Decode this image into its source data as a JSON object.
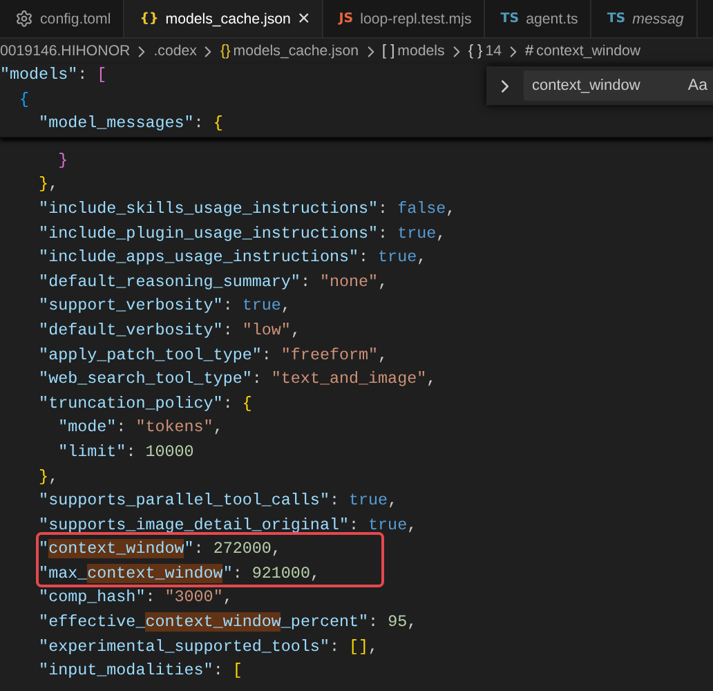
{
  "tabs": [
    {
      "kind": "gear",
      "label": "config.toml",
      "selected": false,
      "italic": false
    },
    {
      "kind": "json",
      "icon": "{}",
      "label": "models_cache.json",
      "selected": true,
      "italic": false,
      "close": "×"
    },
    {
      "kind": "js",
      "icon": "JS",
      "label": "loop-repl.test.mjs",
      "selected": false,
      "italic": false
    },
    {
      "kind": "ts",
      "icon": "TS",
      "label": "agent.ts",
      "selected": false,
      "italic": false
    },
    {
      "kind": "ts",
      "icon": "TS",
      "label": "messag",
      "selected": false,
      "italic": true
    }
  ],
  "breadcrumbs": [
    {
      "label": "0019146.HIHONOR"
    },
    {
      "label": ".codex"
    },
    {
      "icon": "{}",
      "kind": "json",
      "label": "models_cache.json"
    },
    {
      "icon": "[ ]",
      "kind": "array",
      "label": "models"
    },
    {
      "icon": "{ }",
      "kind": "object",
      "label": "14"
    },
    {
      "icon": "#",
      "kind": "number",
      "label": "context_window"
    }
  ],
  "find_widget": {
    "value": "context_window",
    "match_case": "Aa"
  },
  "sticky_lines": [
    [
      {
        "t": "\"models\"",
        "kind": "key"
      },
      {
        "t": ": ",
        "kind": "p"
      },
      {
        "t": "[",
        "kind": "b2"
      }
    ],
    [
      {
        "t": "  {",
        "kind": "b3"
      }
    ],
    [
      {
        "t": "    \"model_messages\"",
        "kind": "key"
      },
      {
        "t": ": ",
        "kind": "p"
      },
      {
        "t": "{",
        "kind": "b1"
      }
    ]
  ],
  "code_blocks": [
    {
      "boxed": false,
      "lines": [
        [
          {
            "t": "      }",
            "kind": "b2"
          }
        ],
        [
          {
            "t": "    }",
            "kind": "b1"
          },
          {
            "t": ",",
            "kind": "p"
          }
        ],
        [
          {
            "t": "    \"include_skills_usage_instructions\"",
            "kind": "key"
          },
          {
            "t": ": ",
            "kind": "p"
          },
          {
            "t": "false",
            "kind": "kw"
          },
          {
            "t": ",",
            "kind": "p"
          }
        ],
        [
          {
            "t": "    \"include_plugin_usage_instructions\"",
            "kind": "key"
          },
          {
            "t": ": ",
            "kind": "p"
          },
          {
            "t": "true",
            "kind": "kw"
          },
          {
            "t": ",",
            "kind": "p"
          }
        ],
        [
          {
            "t": "    \"include_apps_usage_instructions\"",
            "kind": "key"
          },
          {
            "t": ": ",
            "kind": "p"
          },
          {
            "t": "true",
            "kind": "kw"
          },
          {
            "t": ",",
            "kind": "p"
          }
        ],
        [
          {
            "t": "    \"default_reasoning_summary\"",
            "kind": "key"
          },
          {
            "t": ": ",
            "kind": "p"
          },
          {
            "t": "\"none\"",
            "kind": "str"
          },
          {
            "t": ",",
            "kind": "p"
          }
        ],
        [
          {
            "t": "    \"support_verbosity\"",
            "kind": "key"
          },
          {
            "t": ": ",
            "kind": "p"
          },
          {
            "t": "true",
            "kind": "kw"
          },
          {
            "t": ",",
            "kind": "p"
          }
        ],
        [
          {
            "t": "    \"default_verbosity\"",
            "kind": "key"
          },
          {
            "t": ": ",
            "kind": "p"
          },
          {
            "t": "\"low\"",
            "kind": "str"
          },
          {
            "t": ",",
            "kind": "p"
          }
        ],
        [
          {
            "t": "    \"apply_patch_tool_type\"",
            "kind": "key"
          },
          {
            "t": ": ",
            "kind": "p"
          },
          {
            "t": "\"freeform\"",
            "kind": "str"
          },
          {
            "t": ",",
            "kind": "p"
          }
        ],
        [
          {
            "t": "    \"web_search_tool_type\"",
            "kind": "key"
          },
          {
            "t": ": ",
            "kind": "p"
          },
          {
            "t": "\"text_and_image\"",
            "kind": "str"
          },
          {
            "t": ",",
            "kind": "p"
          }
        ],
        [
          {
            "t": "    \"truncation_policy\"",
            "kind": "key"
          },
          {
            "t": ": ",
            "kind": "p"
          },
          {
            "t": "{",
            "kind": "b1"
          }
        ],
        [
          {
            "t": "      \"mode\"",
            "kind": "key"
          },
          {
            "t": ": ",
            "kind": "p"
          },
          {
            "t": "\"tokens\"",
            "kind": "str"
          },
          {
            "t": ",",
            "kind": "p"
          }
        ],
        [
          {
            "t": "      \"limit\"",
            "kind": "key"
          },
          {
            "t": ": ",
            "kind": "p"
          },
          {
            "t": "10000",
            "kind": "num"
          }
        ],
        [
          {
            "t": "    }",
            "kind": "b1"
          },
          {
            "t": ",",
            "kind": "p"
          }
        ],
        [
          {
            "t": "    \"supports_parallel_tool_calls\"",
            "kind": "key"
          },
          {
            "t": ": ",
            "kind": "p"
          },
          {
            "t": "true",
            "kind": "kw"
          },
          {
            "t": ",",
            "kind": "p"
          }
        ],
        [
          {
            "t": "    \"supports_image_detail_original\"",
            "kind": "key"
          },
          {
            "t": ": ",
            "kind": "p"
          },
          {
            "t": "true",
            "kind": "kw"
          },
          {
            "t": ",",
            "kind": "p"
          }
        ]
      ]
    },
    {
      "boxed": true,
      "lines": [
        [
          {
            "t": "    \"",
            "kind": "key"
          },
          {
            "t": "context_window",
            "kind": "key",
            "match": true
          },
          {
            "t": "\"",
            "kind": "key"
          },
          {
            "t": ": ",
            "kind": "p"
          },
          {
            "t": "272000",
            "kind": "num"
          },
          {
            "t": ",",
            "kind": "p"
          }
        ],
        [
          {
            "t": "    \"max_",
            "kind": "key"
          },
          {
            "t": "context_window",
            "kind": "key",
            "match": true
          },
          {
            "t": "\"",
            "kind": "key"
          },
          {
            "t": ": ",
            "kind": "p"
          },
          {
            "t": "921000",
            "kind": "num"
          },
          {
            "t": ",",
            "kind": "p"
          }
        ]
      ]
    },
    {
      "boxed": false,
      "lines": [
        [
          {
            "t": "    \"comp_hash\"",
            "kind": "key"
          },
          {
            "t": ": ",
            "kind": "p"
          },
          {
            "t": "\"3000\"",
            "kind": "str"
          },
          {
            "t": ",",
            "kind": "p"
          }
        ],
        [
          {
            "t": "    \"effective_",
            "kind": "key"
          },
          {
            "t": "context_window",
            "kind": "key",
            "match": true
          },
          {
            "t": "_percent\"",
            "kind": "key"
          },
          {
            "t": ": ",
            "kind": "p"
          },
          {
            "t": "95",
            "kind": "num"
          },
          {
            "t": ",",
            "kind": "p"
          }
        ],
        [
          {
            "t": "    \"experimental_supported_tools\"",
            "kind": "key"
          },
          {
            "t": ": ",
            "kind": "p"
          },
          {
            "t": "[]",
            "kind": "b1"
          },
          {
            "t": ",",
            "kind": "p"
          }
        ],
        [
          {
            "t": "    \"input_modalities\"",
            "kind": "key"
          },
          {
            "t": ": ",
            "kind": "p"
          },
          {
            "t": "[",
            "kind": "b1"
          }
        ]
      ]
    }
  ]
}
